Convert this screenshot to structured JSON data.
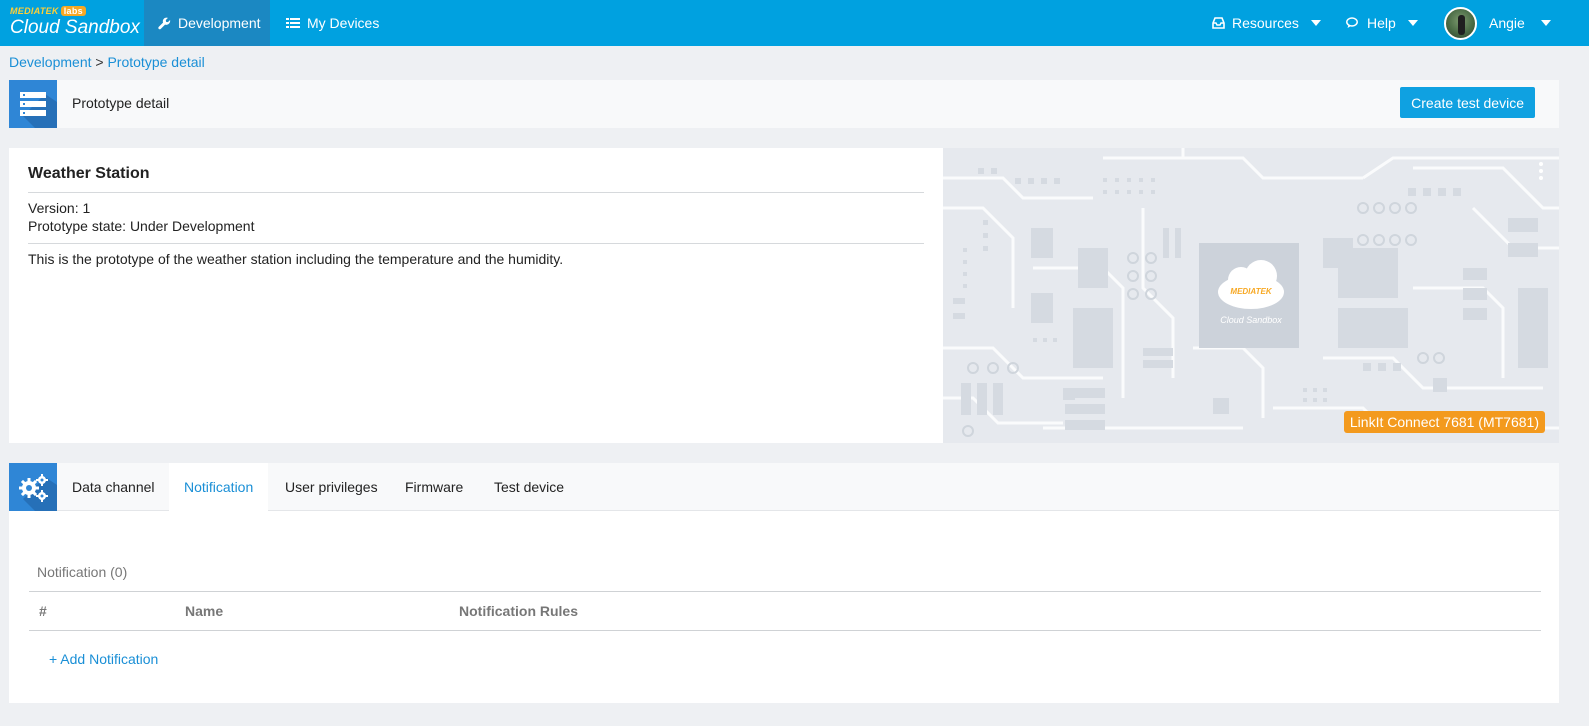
{
  "brand": {
    "top": "MEDIATEK",
    "labs": "labs",
    "name": "Cloud Sandbox"
  },
  "nav": {
    "development": "Development",
    "my_devices": "My Devices",
    "resources": "Resources",
    "help": "Help",
    "user": "Angie"
  },
  "breadcrumb": {
    "root": "Development",
    "separator": " > ",
    "current": "Prototype detail"
  },
  "header": {
    "title": "Prototype detail",
    "create_button": "Create test device"
  },
  "prototype": {
    "name": "Weather Station",
    "version": "Version: 1",
    "state": "Prototype state: Under Development",
    "description": "This is the prototype of the weather station including the temperature and the humidity.",
    "board_logo_top": "MEDIATEK",
    "board_logo_bottom": "Cloud Sandbox",
    "chip": "LinkIt Connect 7681 (MT7681)"
  },
  "tabs": [
    {
      "label": "Data channel"
    },
    {
      "label": "Notification"
    },
    {
      "label": "User privileges"
    },
    {
      "label": "Firmware"
    },
    {
      "label": "Test device"
    }
  ],
  "active_tab": "Notification",
  "notifications": {
    "title": "Notification (0)",
    "columns": [
      "#",
      "Name",
      "Notification Rules"
    ],
    "rows": [],
    "add_label": "+ Add Notification"
  },
  "colors": {
    "topbar": "#00a1e0",
    "nav_active": "#1b88c2",
    "accent": "#1a8fd6",
    "icon_block": "#2f86d6",
    "badge": "#f39a1e"
  }
}
